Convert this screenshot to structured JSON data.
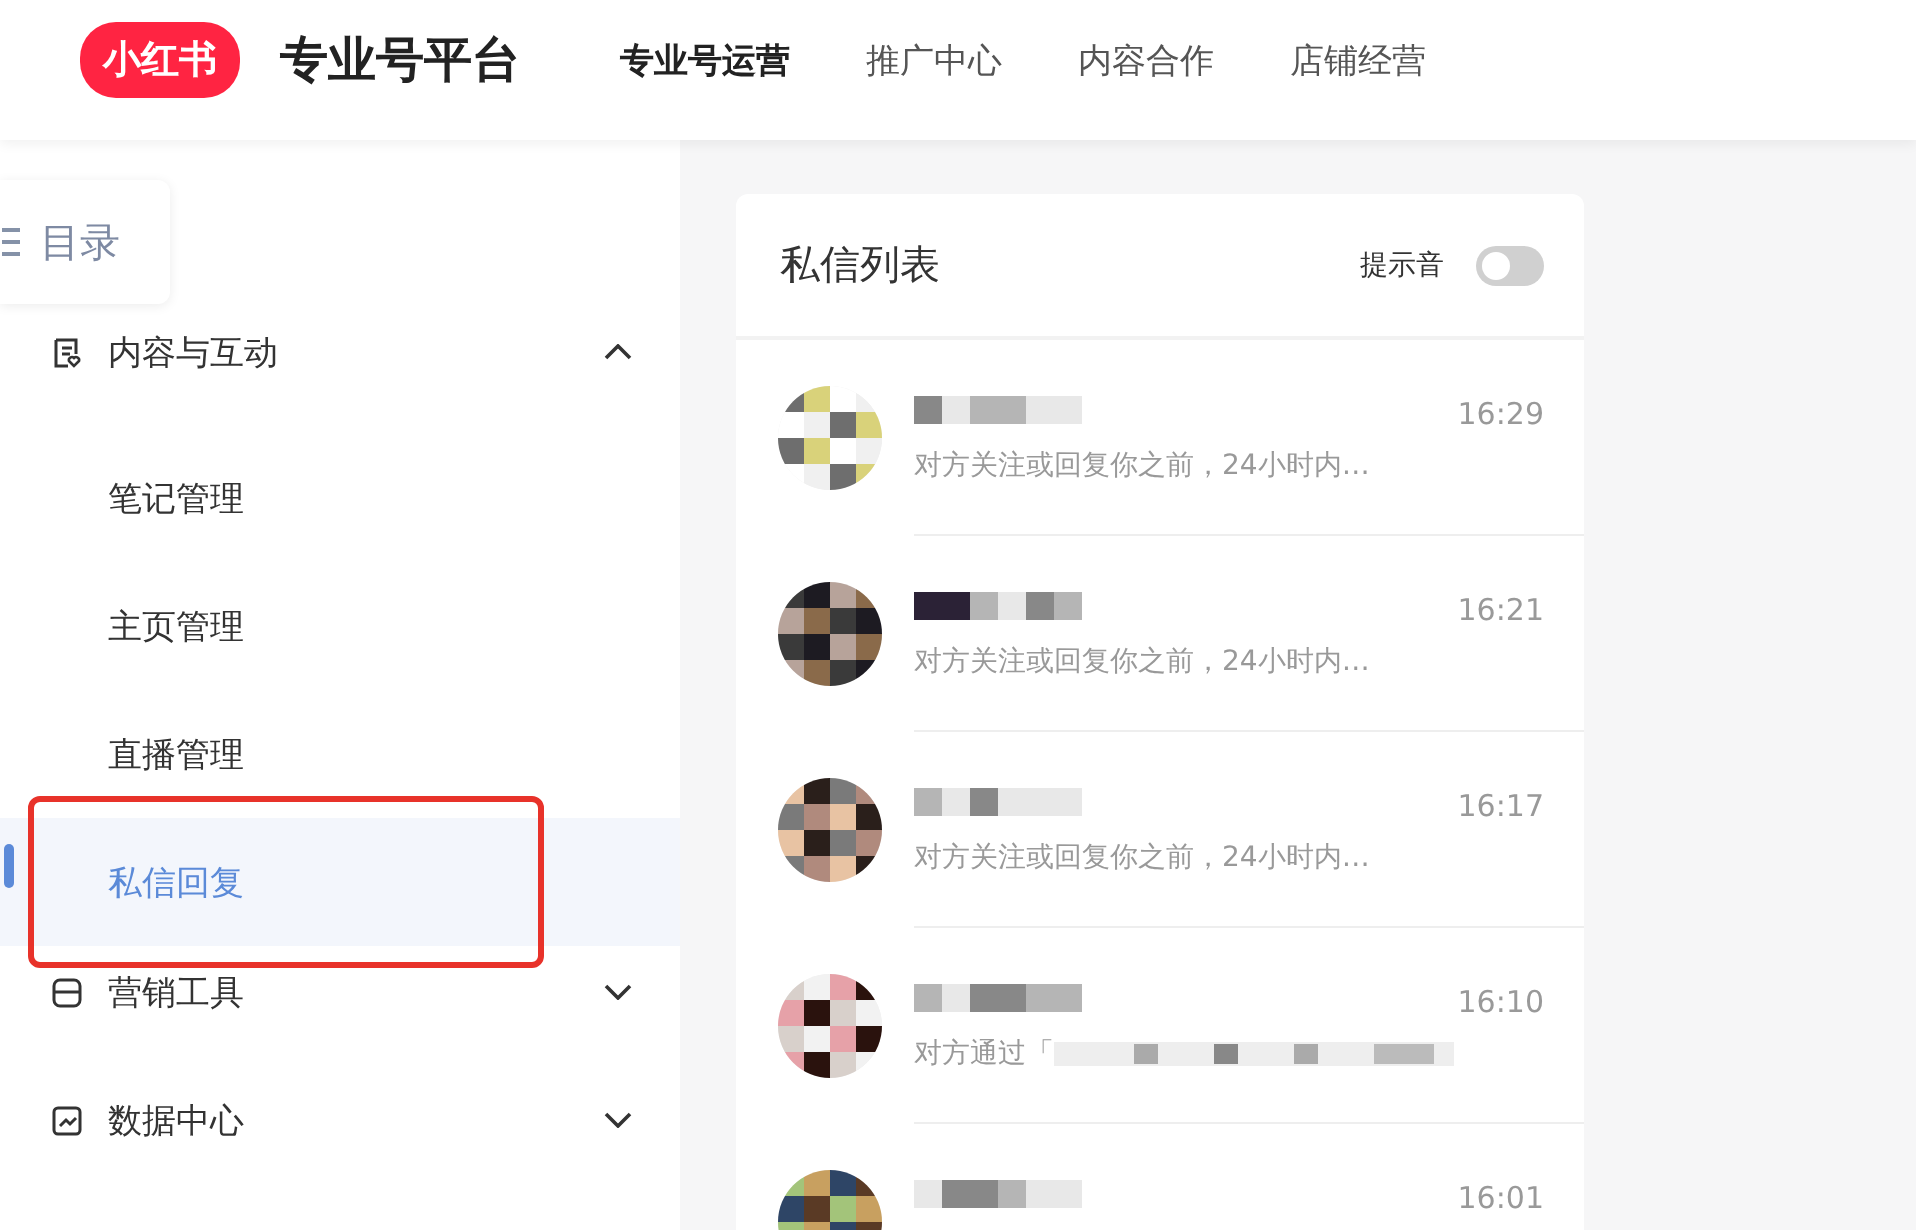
{
  "header": {
    "logo": "小红书",
    "title": "专业号平台",
    "nav": [
      {
        "label": "专业号运营",
        "selected": true
      },
      {
        "label": "推广中心",
        "selected": false
      },
      {
        "label": "内容合作",
        "selected": false
      },
      {
        "label": "店铺经营",
        "selected": false
      }
    ]
  },
  "toc_button": {
    "label": "目录"
  },
  "sidebar": {
    "items": [
      {
        "label": "内容与互动",
        "kind": "group",
        "expanded": true,
        "children": [
          {
            "label": "笔记管理",
            "selected": false
          },
          {
            "label": "主页管理",
            "selected": false
          },
          {
            "label": "直播管理",
            "selected": false
          },
          {
            "label": "私信回复",
            "selected": true
          }
        ]
      },
      {
        "label": "营销工具",
        "kind": "group",
        "expanded": false
      },
      {
        "label": "数据中心",
        "kind": "group",
        "expanded": false
      }
    ]
  },
  "messages_panel": {
    "title": "私信列表",
    "sound_label": "提示音",
    "sound_on": false,
    "messages": [
      {
        "preview": "对方关注或回复你之前，24小时内…",
        "time": "16:29"
      },
      {
        "preview": "对方关注或回复你之前，24小时内…",
        "time": "16:21"
      },
      {
        "preview": "对方关注或回复你之前，24小时内…",
        "time": "16:17"
      },
      {
        "preview": "对方通过「",
        "time": "16:10"
      },
      {
        "time": "16:01"
      }
    ]
  }
}
